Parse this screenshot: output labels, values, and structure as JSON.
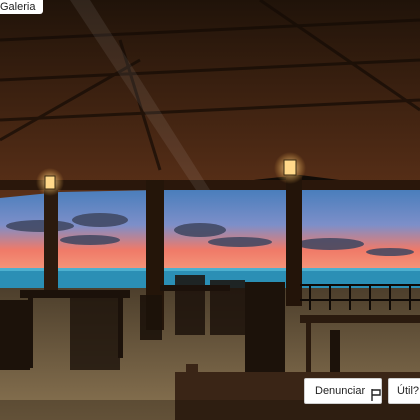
{
  "overlay": {
    "gallery_label": "Galeria"
  },
  "actions": {
    "report_label": "Denunciar",
    "useful_label": "Útil?"
  },
  "icons": {
    "report": "flag-icon"
  },
  "colors": {
    "sky_top": "#3b79b8",
    "sky_sunset": "#f07a68",
    "sea": "#2b8fb5",
    "wood": "#5a3018",
    "lamp": "#ffd98a",
    "sand": "#8a7452"
  }
}
